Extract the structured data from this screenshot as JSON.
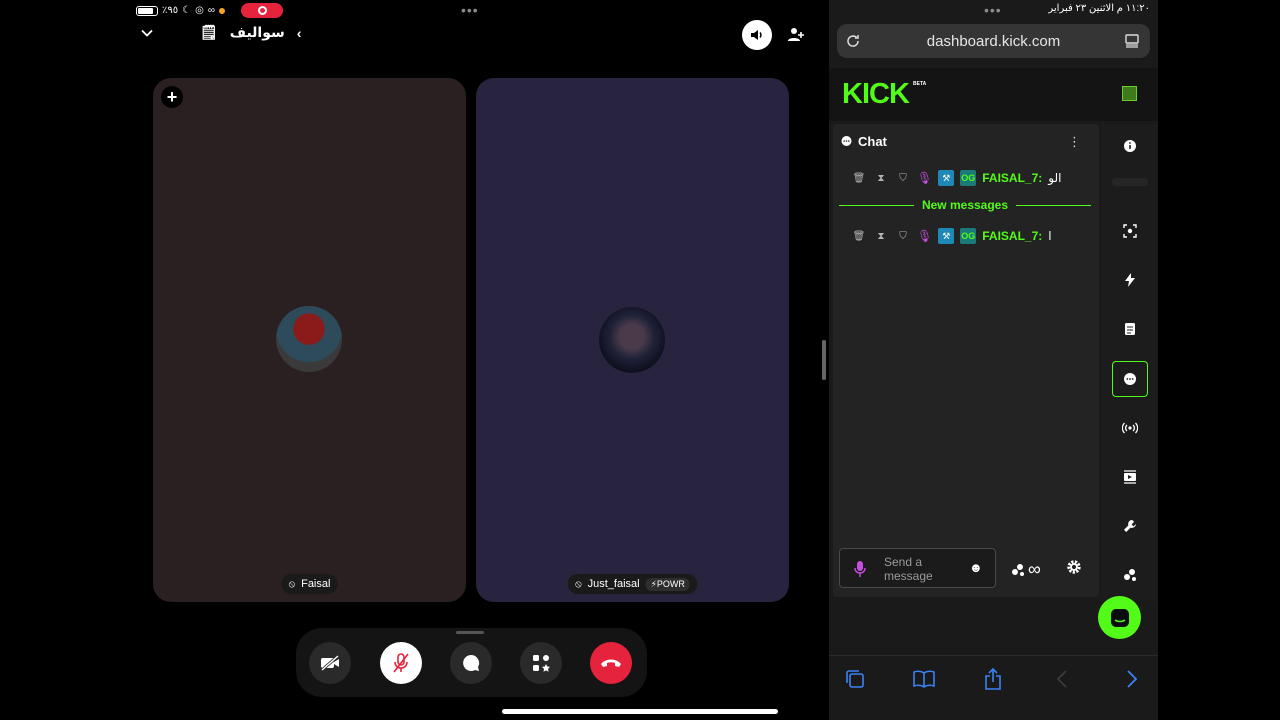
{
  "status_left": {
    "battery_percent": "٪٩٥"
  },
  "status_right": {
    "text": "١١:٢٠ م  الاثنين ٢٣ فبراير"
  },
  "channel": {
    "name": "سواليف"
  },
  "participants": [
    {
      "name": "Faisal"
    },
    {
      "name": "Just_faisal",
      "badge": "POWR"
    }
  ],
  "browser": {
    "url": "dashboard.kick.com"
  },
  "kick": {
    "logo": "KICK",
    "beta": "BETA"
  },
  "chat": {
    "title": "Chat",
    "messages": [
      {
        "user": "FAISAL_7:",
        "text": "الو"
      },
      {
        "user": "FAISAL_7:",
        "text": "ا"
      }
    ],
    "new_messages_label": "New messages",
    "composer_placeholder": "Send a message",
    "points": "∞"
  },
  "colors": {
    "accent": "#53fc18",
    "end_call": "#e5233c"
  }
}
